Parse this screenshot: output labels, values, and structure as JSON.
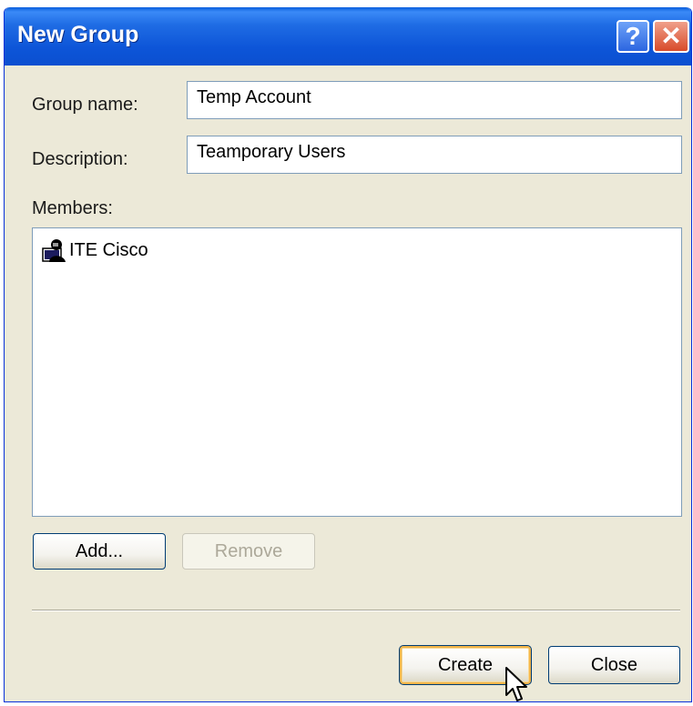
{
  "window": {
    "title": "New Group",
    "help_label": "?",
    "close_label": "✕"
  },
  "form": {
    "group_name_label": "Group name:",
    "group_name_value": "Temp Account",
    "description_label": "Description:",
    "description_value": "Teamporary Users",
    "members_label": "Members:"
  },
  "members": {
    "items": [
      {
        "name": "ITE Cisco",
        "icon": "user-icon"
      }
    ]
  },
  "buttons": {
    "add_label": "Add...",
    "remove_label": "Remove",
    "create_label": "Create",
    "close_label": "Close"
  },
  "colors": {
    "titlebar": "#0b4fd0",
    "dialog_bg": "#ece9d8",
    "default_button_highlight": "#f0b44a"
  }
}
